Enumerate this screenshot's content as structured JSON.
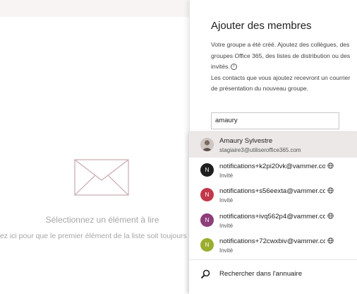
{
  "reading_pane": {
    "empty_title": "Sélectionnez un élément à lire",
    "empty_hint": "uez ici pour que le premier élément de la liste soit toujours sé"
  },
  "panel": {
    "title": "Ajouter des membres",
    "description_1": "Votre groupe a été créé. Ajoutez des collègues, des groupes Office 365, des listes de distribution ou des invités.",
    "description_2": "Les contacts que vous ajoutez recevront un courrier de présentation du nouveau groupe.",
    "search_value": "amaury"
  },
  "suggestions": [
    {
      "name": "Amaury Sylvestre",
      "sub": "stagiaire3@utiliseroffice365.com",
      "initial": "",
      "color": "#bfb5b0",
      "selected": true,
      "guest": false
    },
    {
      "name": "notifications+k2pi20vk@vammer.co",
      "sub": "Invité",
      "initial": "N",
      "color": "#1e1e1e",
      "selected": false,
      "guest": true
    },
    {
      "name": "notifications+s56eexta@vammer.co",
      "sub": "Invité",
      "initial": "N",
      "color": "#c3374a",
      "selected": false,
      "guest": true
    },
    {
      "name": "notifications+ivq562p4@vammer.co",
      "sub": "Invité",
      "initial": "N",
      "color": "#8e3c7a",
      "selected": false,
      "guest": true
    },
    {
      "name": "notifications+72cwxbiv@vammer.co",
      "sub": "Invité",
      "initial": "N",
      "color": "#9aad2d",
      "selected": false,
      "guest": true
    }
  ],
  "directory": {
    "label": "Rechercher dans l'annuaire"
  }
}
